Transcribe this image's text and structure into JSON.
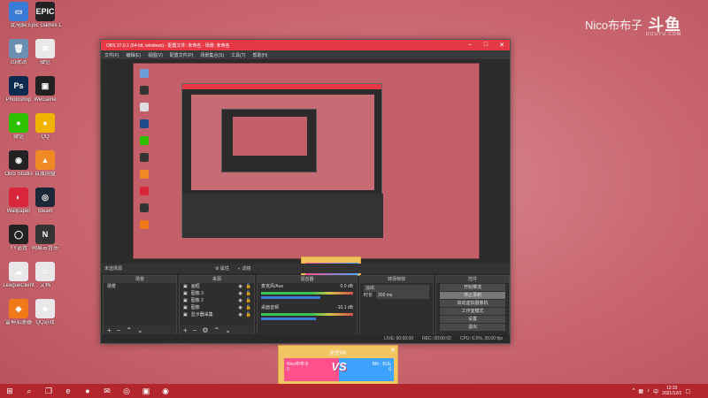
{
  "watermark": {
    "name": "Nico布布子",
    "logo": "斗鱼",
    "logo_sub": "DOUYU.COM"
  },
  "desktop_icons": [
    {
      "label": "此电脑",
      "color": "#3a7bd5",
      "glyph": "▭",
      "icon": "computer-icon"
    },
    {
      "label": "Epic Games Launcher",
      "color": "#222222",
      "glyph": "EPIC",
      "icon": "epic-icon"
    },
    {
      "label": "回收站",
      "color": "#6b8fb0",
      "glyph": "🗑",
      "icon": "recycle-bin-icon"
    },
    {
      "label": "微信",
      "color": "#e8e8e8",
      "glyph": "✉",
      "icon": "app-icon"
    },
    {
      "label": "Photoshop",
      "color": "#0a2b4f",
      "glyph": "Ps",
      "icon": "photoshop-icon"
    },
    {
      "label": "WeGame",
      "color": "#222222",
      "glyph": "▣",
      "icon": "wegame-icon"
    },
    {
      "label": "微信",
      "color": "#2dc100",
      "glyph": "●",
      "icon": "wechat-icon"
    },
    {
      "label": "QQ",
      "color": "#f0b400",
      "glyph": "●",
      "icon": "qq-game-icon"
    },
    {
      "label": "OBS Studio",
      "color": "#222222",
      "glyph": "◉",
      "icon": "obs-icon"
    },
    {
      "label": "百度网盘",
      "color": "#f08a24",
      "glyph": "▲",
      "icon": "tool-icon"
    },
    {
      "label": "Wallpaper",
      "color": "#d9263b",
      "glyph": "◐",
      "icon": "wallpaper-icon"
    },
    {
      "label": "Steam",
      "color": "#1b2838",
      "glyph": "◎",
      "icon": "steam-icon"
    },
    {
      "label": "YY语音",
      "color": "#222222",
      "glyph": "◯",
      "icon": "yy-icon"
    },
    {
      "label": "网易云音乐",
      "color": "#333333",
      "glyph": "N",
      "icon": "netease-icon"
    },
    {
      "label": "LeagueClient",
      "color": "#e8e8e8",
      "glyph": "☁",
      "icon": "cloud-icon"
    },
    {
      "label": "文档",
      "color": "#e8e8e8",
      "glyph": "≡",
      "icon": "document-icon"
    },
    {
      "label": "雷神加速器",
      "color": "#f07a1a",
      "glyph": "◆",
      "icon": "thunder-icon"
    },
    {
      "label": "QQ游戏",
      "color": "#e8e8e8",
      "glyph": "☻",
      "icon": "qq-icon"
    }
  ],
  "obs": {
    "title": "OBS 27.0.1 (64-bit, windows) - 配置文件: 未命名 - 场景: 未命名",
    "menu": [
      "文件(F)",
      "编辑(E)",
      "视图(V)",
      "配置文件(P)",
      "场景集合(S)",
      "工具(T)",
      "帮助(H)"
    ],
    "status_line": "未选择源",
    "status_props": "属性",
    "status_filters": "滤镜",
    "scenes": {
      "header": "场景",
      "items": [
        "场景"
      ]
    },
    "sources": {
      "header": "来源",
      "items": [
        "画框",
        "图像 3",
        "图像 2",
        "图像",
        "显示器采集"
      ]
    },
    "mixer": {
      "header": "混音器",
      "channels": [
        {
          "name": "麦克风/Aux",
          "db": "0.0 dB"
        },
        {
          "name": "桌面音频",
          "db": "-10.1 dB"
        }
      ]
    },
    "transitions": {
      "header": "转场特效",
      "type": "淡出",
      "duration_label": "时长",
      "duration": "300 ms"
    },
    "controls": {
      "header": "控件",
      "buttons": [
        "开始推流",
        "停止录制",
        "启动虚拟摄像机",
        "工作室模式",
        "设置",
        "退出"
      ]
    },
    "statusbar": {
      "live": "LIVE: 00:00:00",
      "rec": "REC: 00:00:02",
      "cpu": "CPU: 6.5%, 30.00 fps"
    }
  },
  "pk_card": {
    "title": "全民PK",
    "left_name": "Nico布布子",
    "left_score": "0",
    "right_name": "BN - 石头",
    "right_score": "0",
    "vs": "VS"
  },
  "taskbar": {
    "time": "12:33",
    "date": "2021/12/1",
    "apps": [
      "windows-icon",
      "search-icon",
      "taskview-icon",
      "edge-icon",
      "game-icon",
      "wechat-icon",
      "steam-icon",
      "app-icon",
      "obs-icon"
    ]
  }
}
